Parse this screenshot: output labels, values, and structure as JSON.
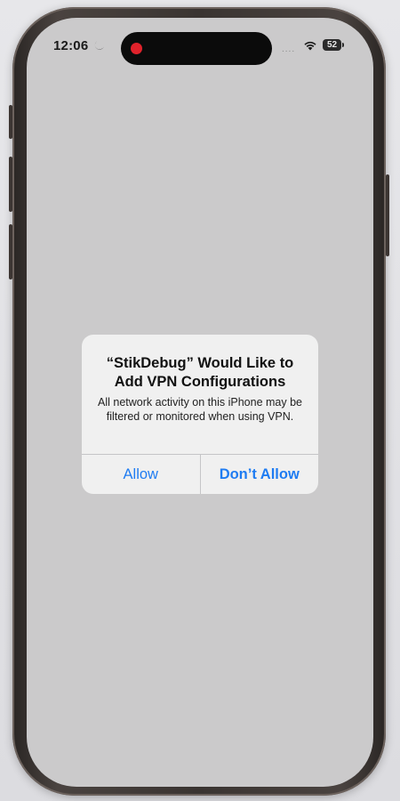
{
  "status_bar": {
    "time": "12:06",
    "time_icon": "moon-icon",
    "signal_dots": "....",
    "wifi_icon": "wifi-icon",
    "battery_level": "52"
  },
  "dynamic_island": {
    "indicator": "recording-dot",
    "indicator_color": "#e0222b"
  },
  "alert": {
    "title": "“StikDebug” Would Like to Add VPN Configurations",
    "message": "All network activity on this iPhone may be filtered or monitored when using VPN.",
    "buttons": {
      "allow": "Allow",
      "dont_allow": "Don’t Allow"
    },
    "accent_color": "#1f7cf2"
  }
}
